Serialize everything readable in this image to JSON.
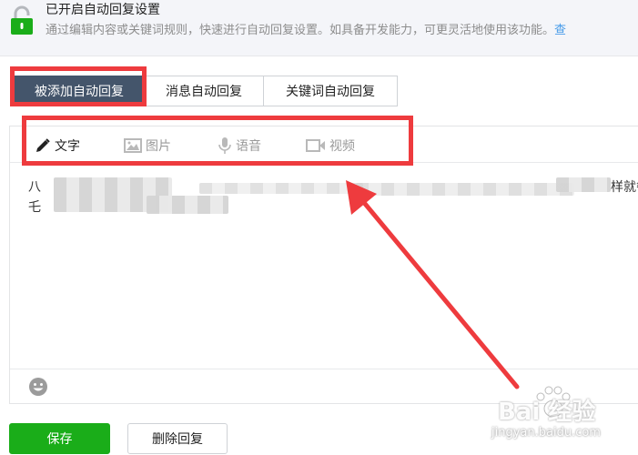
{
  "notice": {
    "title": "已开启自动回复设置",
    "description": "通过编辑内容或关键词规则，快速进行自动回复设置。如具备开发能力，可更灵活地使用该功能。",
    "link_text": "查"
  },
  "tabs": [
    {
      "label": "被添加自动回复",
      "active": true
    },
    {
      "label": "消息自动回复",
      "active": false
    },
    {
      "label": "关键词自动回复",
      "active": false
    }
  ],
  "toolbar": {
    "text_label": "文字",
    "image_label": "图片",
    "voice_label": "语音",
    "video_label": "视频"
  },
  "content": {
    "line1_start": "八",
    "line1_end": "样就餐。",
    "line2_start": "乇"
  },
  "buttons": {
    "save_label": "保存",
    "delete_label": "删除回复"
  },
  "watermark": {
    "brand": "Bai 经验",
    "url": "jingyan.baidu.com"
  },
  "colors": {
    "accent_green": "#1aad19",
    "active_tab": "#44556b",
    "annotation_red": "#ee3b3e",
    "link_blue": "#459ae9"
  }
}
